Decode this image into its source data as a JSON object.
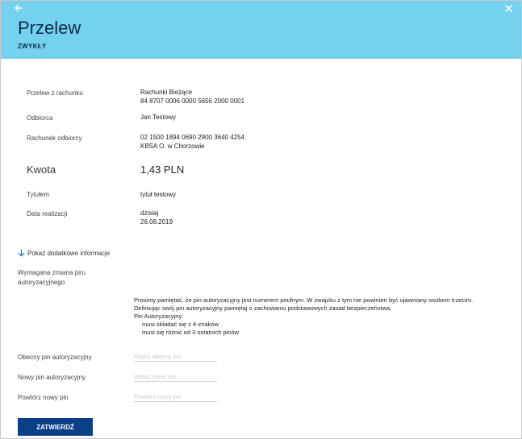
{
  "header": {
    "title": "Przelew",
    "subtitle": "ZWYKŁY",
    "back_icon": "arrow-left-icon",
    "close_icon": "close-icon",
    "background_color": "#74d2ef"
  },
  "details": {
    "from_account": {
      "label": "Przelew z rachunku",
      "value_line1": "Rachunki Bieżące",
      "value_line2": "84 8707 0006 0000 5656 2000 0001"
    },
    "recipient": {
      "label": "Odbiorca",
      "value": "Jan Testowy"
    },
    "recipient_account": {
      "label": "Rachunek odbiorcy",
      "value_line1": "02 1500 1894 0690 2900 3640 4254",
      "value_line2": "KBSA O. w Chorzowie"
    },
    "amount": {
      "label": "Kwota",
      "value": "1,43 PLN"
    },
    "title_field": {
      "label": "Tytułem",
      "value": "tytuł testowy"
    },
    "execution_date": {
      "label": "Data realizacji",
      "value_line1": "dzisiaj",
      "value_line2": "26.08.2019"
    }
  },
  "more_info": {
    "label": "Pokaż dodatkowe informacje",
    "icon": "arrow-down-icon"
  },
  "pin_change": {
    "required_label": "Wymagana zmiana piru autoryzacyjnego",
    "notice_line1": "Prosimy pamiętać, że pin autoryzacyjny jest numerem poufnym. W związku z tym nie powinien być ujawniany osobom trzecim.",
    "notice_line2": "Definiując swój pin autoryzacyjny pamiętaj o zachowaniu podstawowych zasad bezpieczeństwa.",
    "notice_line3": "Pin Autoryzacyjny:",
    "rule1": "musi składać się z 4-znaków",
    "rule2": "musi się różnić od 3 ostatnich pinów",
    "current_pin": {
      "label": "Obecny pin autoryzacyjny",
      "placeholder": "Wpisz obecny pin",
      "value": ""
    },
    "new_pin": {
      "label": "Nowy pin autoryzacyjny",
      "placeholder": "Wpisz nowy pin",
      "value": ""
    },
    "repeat_pin": {
      "label": "Powtórz nowy pin",
      "placeholder": "Powtórz nowy pin",
      "value": ""
    }
  },
  "actions": {
    "confirm_label": "ZATWIERDŹ",
    "confirm_color": "#0b3f87"
  }
}
